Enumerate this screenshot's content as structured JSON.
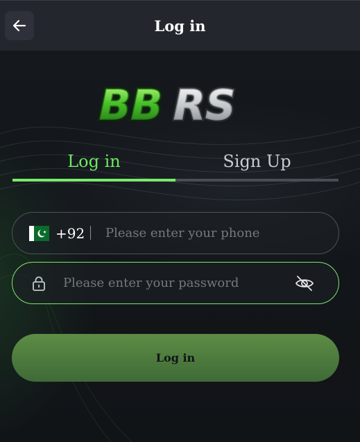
{
  "header": {
    "title": "Log in",
    "back_icon": "arrow-left-icon"
  },
  "logo": {
    "text": "BBRS"
  },
  "tabs": [
    {
      "label": "Log in",
      "active": true
    },
    {
      "label": "Sign Up",
      "active": false
    }
  ],
  "phone": {
    "flag_icon": "pakistan-flag-icon",
    "dial_code": "+92",
    "placeholder": "Please enter your phone",
    "value": ""
  },
  "password": {
    "lock_icon": "lock-icon",
    "placeholder": "Please enter your password",
    "value": "",
    "visibility_icon": "eye-off-icon"
  },
  "submit": {
    "label": "Log in"
  },
  "colors": {
    "accent": "#79ea6c",
    "header_bg": "#23262d",
    "page_bg": "#121519",
    "button_bg": "#4c7a3d"
  }
}
